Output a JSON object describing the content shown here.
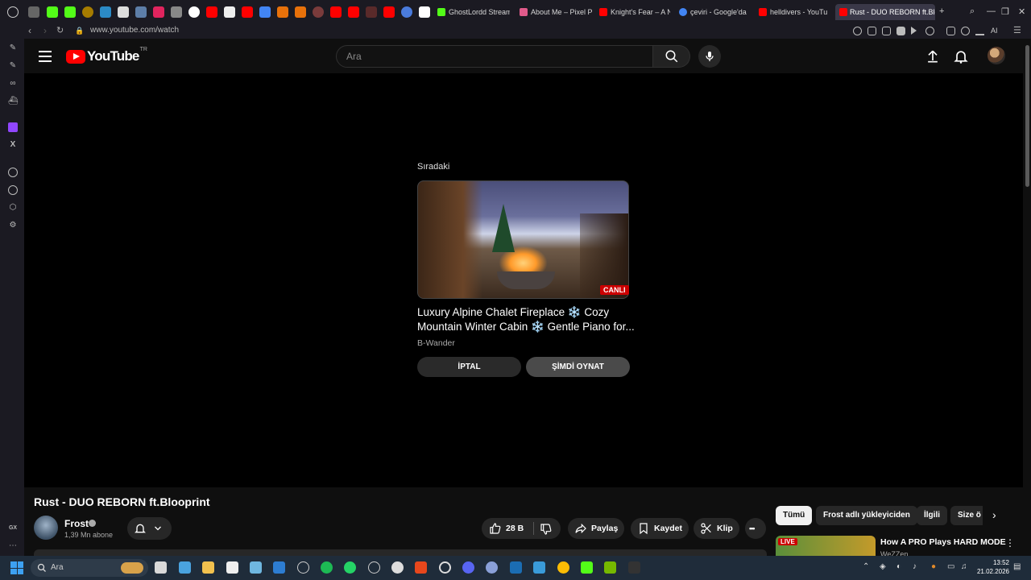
{
  "browser": {
    "tabs": [
      {
        "label": "GhostLordd Stream",
        "favicon_color": "#53fc18"
      },
      {
        "label": "About Me – Pixel P",
        "favicon_color": "#e05a8a"
      },
      {
        "label": "Knight's Fear – A N",
        "favicon_color": "#ff0000"
      },
      {
        "label": "çeviri - Google'da",
        "favicon_color": "#4285f4"
      },
      {
        "label": "helldivers - YouTu",
        "favicon_color": "#ff0000"
      },
      {
        "label": "Rust - DUO REBORN ft.Blo",
        "favicon_color": "#ff0000",
        "active": true
      }
    ],
    "new_tab_label": "+",
    "url": "www.youtube.com/watch",
    "ai_label": "AI"
  },
  "youtube": {
    "logo_text": "YouTube",
    "country_code": "TR",
    "search_placeholder": "Ara"
  },
  "up_next": {
    "label": "Sıradaki",
    "live_badge": "CANLI",
    "title": "Luxury Alpine Chalet Fireplace ❄️ Cozy Mountain Winter Cabin ❄️ Gentle Piano for...",
    "channel": "B-Wander",
    "cancel_label": "İPTAL",
    "play_now_label": "ŞİMDİ OYNAT"
  },
  "video": {
    "title": "Rust - DUO REBORN ft.Blooprint",
    "channel_name": "Frost",
    "subscribers": "1,39 Mn abone",
    "likes": "28 B",
    "share_label": "Paylaş",
    "save_label": "Kaydet",
    "clip_label": "Klip",
    "more_label": "•••"
  },
  "chips": [
    "Tümü",
    "Frost adlı yükleyiciden",
    "İlgili",
    "Size ö"
  ],
  "recommendation": {
    "live_badge": "LIVE",
    "title": "How A PRO Plays HARD MODE",
    "channel": "WeZZen"
  },
  "taskbar": {
    "search_label": "Ara",
    "time": "13:52",
    "date": "21.02.2026",
    "start_color": "#3da1f2"
  }
}
